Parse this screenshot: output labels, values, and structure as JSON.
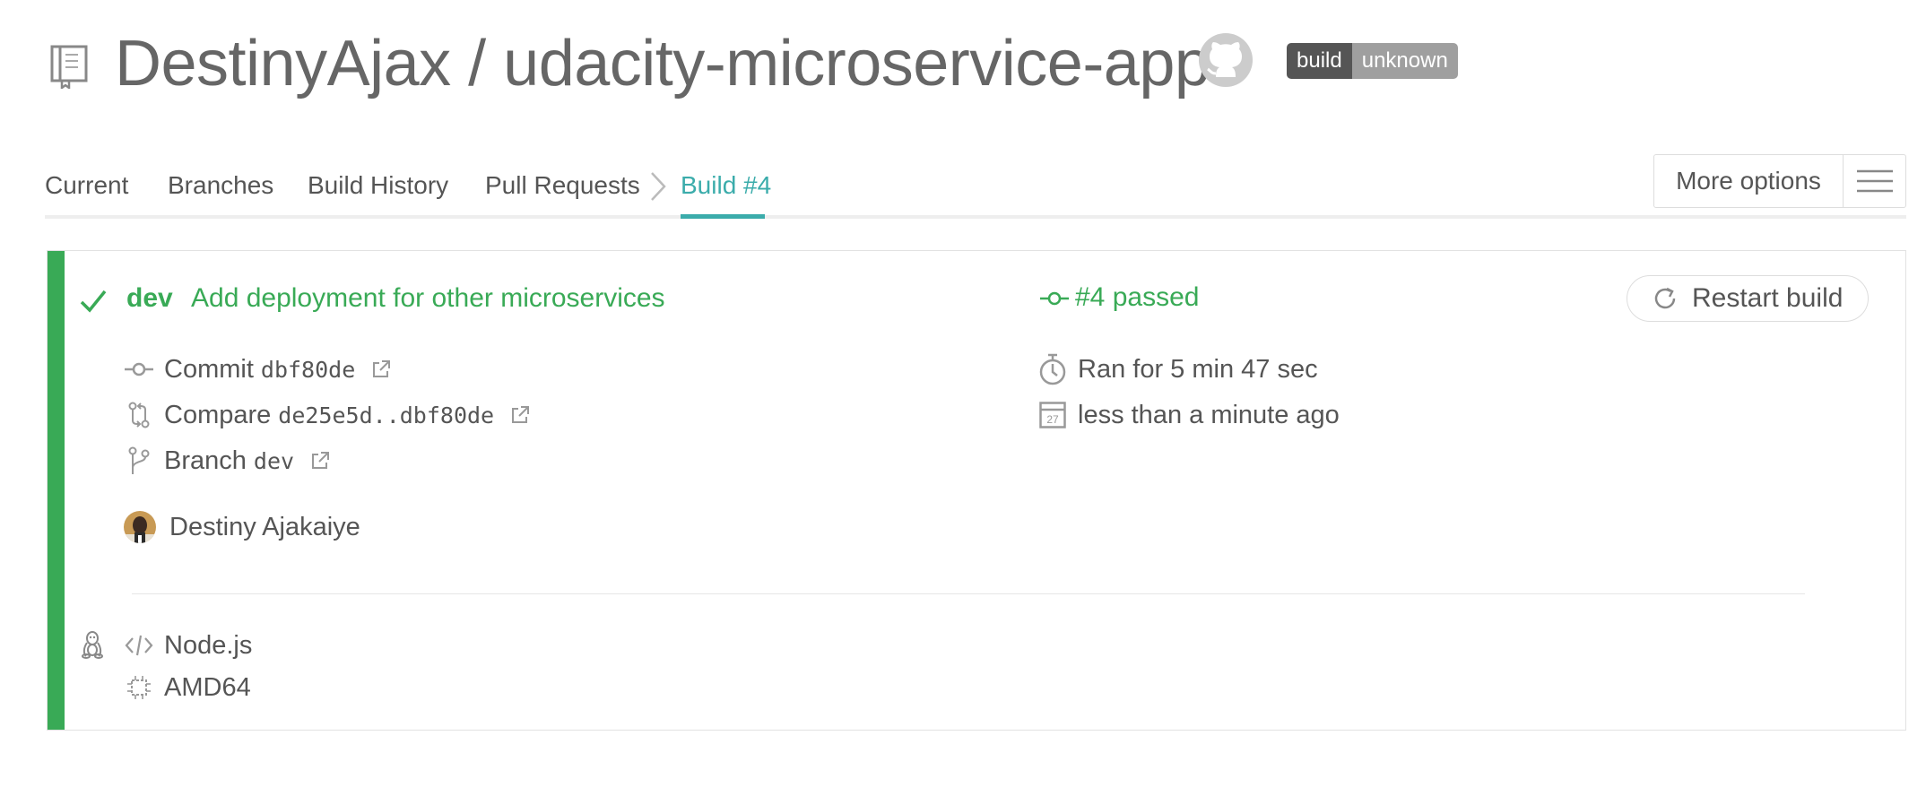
{
  "header": {
    "repo_title": "DestinyAjax / udacity-microservice-app",
    "badge": {
      "left": "build",
      "right": "unknown"
    }
  },
  "tabs": {
    "current": "Current",
    "branches": "Branches",
    "build_history": "Build History",
    "pull_requests": "Pull Requests",
    "active_build": "Build #4",
    "more_options": "More options"
  },
  "build": {
    "branch": "dev",
    "commit_message": "Add deployment for other microservices",
    "state_text": "#4 passed",
    "restart_label": "Restart build",
    "commit": {
      "label": "Commit",
      "sha": "dbf80de"
    },
    "compare": {
      "label": "Compare",
      "range": "de25e5d..dbf80de"
    },
    "branch_row": {
      "label": "Branch",
      "name": "dev"
    },
    "author": "Destiny Ajakaiye",
    "duration": "Ran for 5 min 47 sec",
    "finished": "less than a minute ago",
    "calendar_day": "27",
    "language": "Node.js",
    "arch": "AMD64"
  },
  "colors": {
    "passed_green": "#39aa56",
    "active_tab_teal": "#3bacab",
    "badge_dark": "#555555",
    "badge_grey": "#9f9f9f"
  },
  "icons": {
    "repo": "repo-book-icon",
    "github": "github-icon",
    "check": "check-icon",
    "commit": "commit-icon",
    "compare": "compare-icon",
    "branch": "branch-icon",
    "external": "external-link-icon",
    "stopwatch": "stopwatch-icon",
    "calendar": "calendar-icon",
    "linux": "linux-icon",
    "code": "code-icon",
    "chip": "cpu-chip-icon",
    "menu": "hamburger-icon",
    "restart": "restart-icon"
  }
}
